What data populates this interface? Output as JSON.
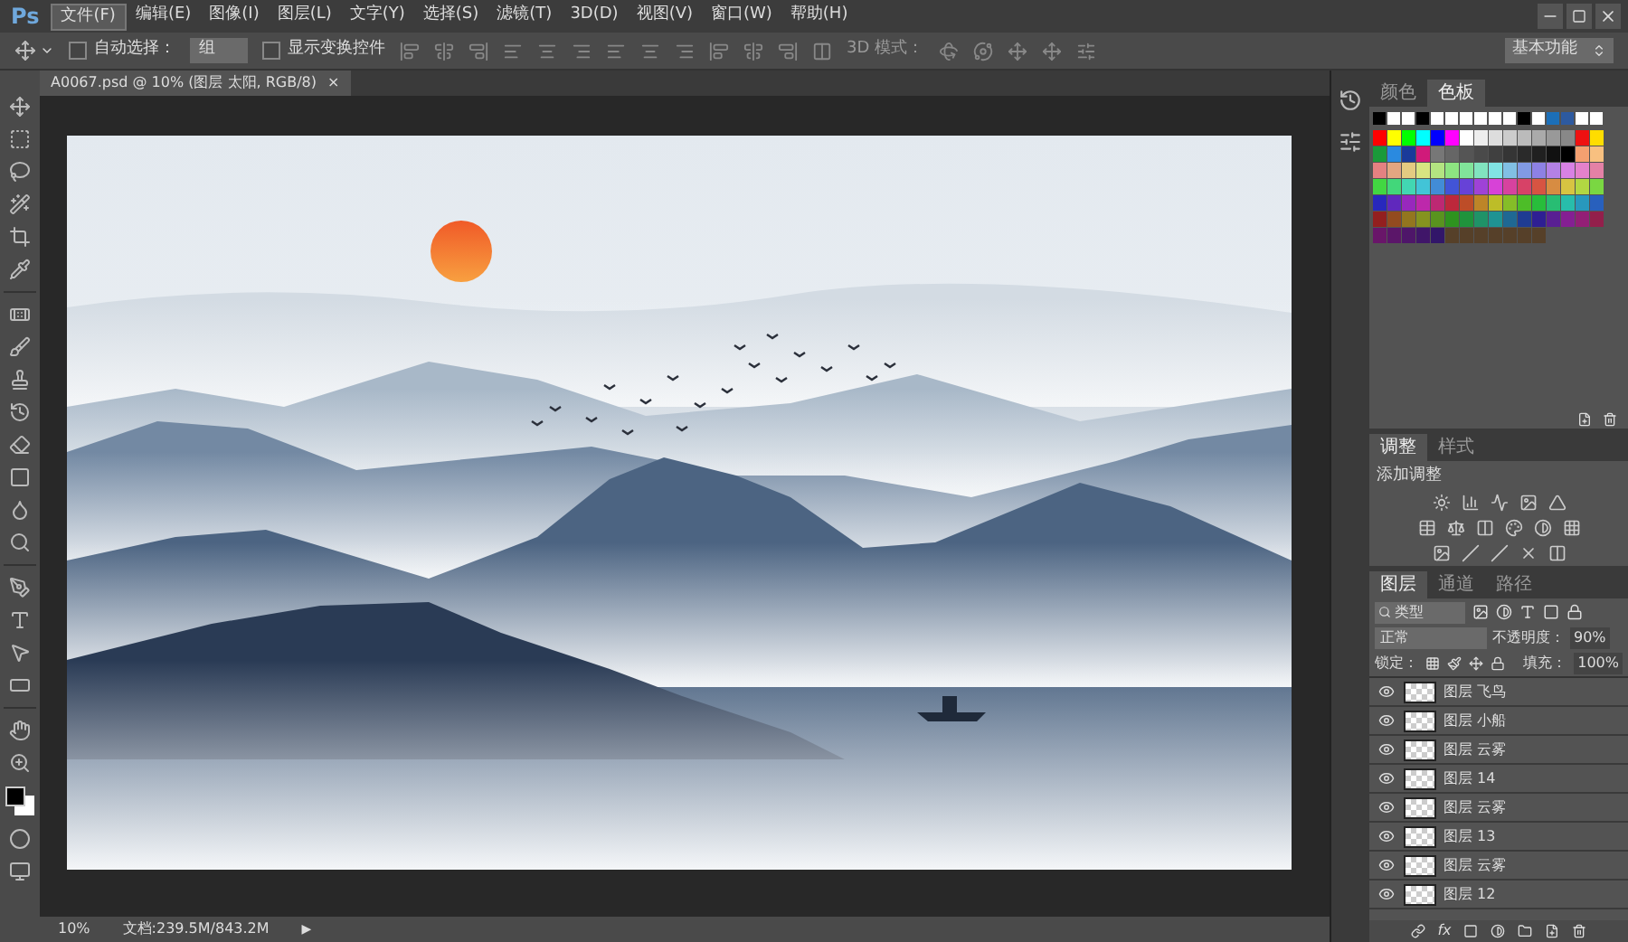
{
  "app_logo": "Ps",
  "menu": [
    {
      "label": "文件(F)",
      "selected": true
    },
    {
      "label": "编辑(E)",
      "selected": false
    },
    {
      "label": "图像(I)",
      "selected": false
    },
    {
      "label": "图层(L)",
      "selected": false
    },
    {
      "label": "文字(Y)",
      "selected": false
    },
    {
      "label": "选择(S)",
      "selected": false
    },
    {
      "label": "滤镜(T)",
      "selected": false
    },
    {
      "label": "3D(D)",
      "selected": false
    },
    {
      "label": "视图(V)",
      "selected": false
    },
    {
      "label": "窗口(W)",
      "selected": false
    },
    {
      "label": "帮助(H)",
      "selected": false
    }
  ],
  "options_bar": {
    "auto_select": {
      "label": "自动选择：",
      "checked": false
    },
    "auto_select_target": "组",
    "show_transform": {
      "label": "显示变换控件",
      "checked": false
    },
    "mode_3d_label": "3D 模式：",
    "workspace": "基本功能"
  },
  "document_tab": {
    "title": "A0067.psd @ 10% (图层 太阳, RGB/8)",
    "close": "×"
  },
  "status_bar": {
    "zoom": "10%",
    "doc_size": "文档:239.5M/843.2M",
    "arrow": "▶"
  },
  "color_panel": {
    "tabs": [
      {
        "label": "颜色",
        "selected": false
      },
      {
        "label": "色板",
        "selected": true
      }
    ]
  },
  "adjustments_panel": {
    "tabs": [
      {
        "label": "调整",
        "selected": true
      },
      {
        "label": "样式",
        "selected": false
      }
    ],
    "heading": "添加调整"
  },
  "layers_panel": {
    "tabs": [
      {
        "label": "图层",
        "selected": true
      },
      {
        "label": "通道",
        "selected": false
      },
      {
        "label": "路径",
        "selected": false
      }
    ],
    "filter": "类型",
    "blend_mode": "正常",
    "opacity_label": "不透明度：",
    "opacity": "90%",
    "lock_label": "锁定：",
    "fill_label": "填充：",
    "fill": "100%",
    "fx": "fx",
    "layers": [
      {
        "name": "图层 飞鸟",
        "visible": true
      },
      {
        "name": "图层 小船",
        "visible": true
      },
      {
        "name": "图层 云雾",
        "visible": true
      },
      {
        "name": "图层 14",
        "visible": true
      },
      {
        "name": "图层 云雾",
        "visible": true
      },
      {
        "name": "图层 13",
        "visible": true
      },
      {
        "name": "图层 云雾",
        "visible": true
      },
      {
        "name": "图层 12",
        "visible": true
      }
    ]
  }
}
